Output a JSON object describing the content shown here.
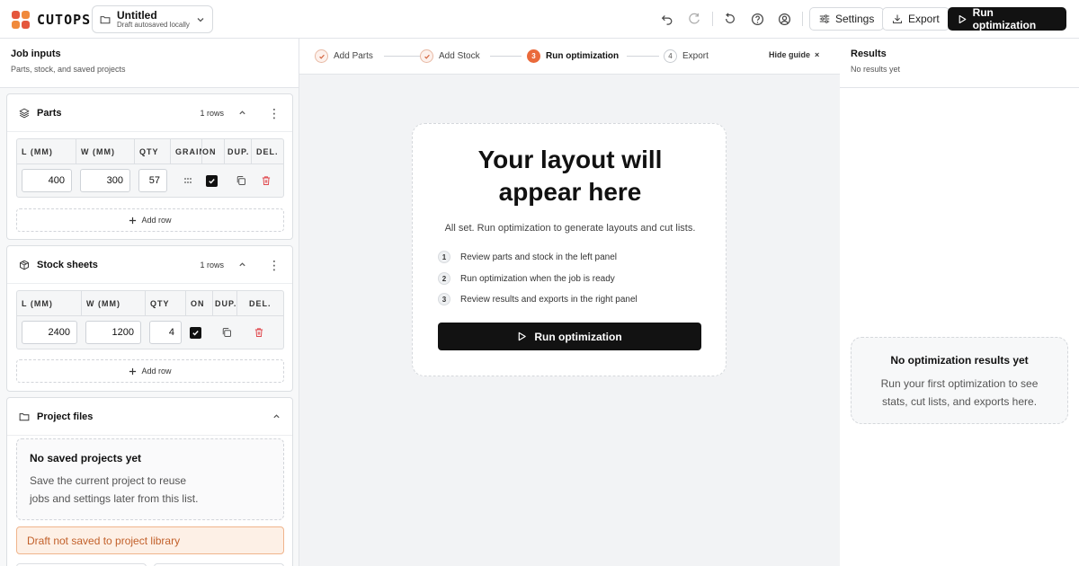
{
  "header": {
    "logo_text": "CUTOPS",
    "project_title": "Untitled",
    "project_status": "Draft autosaved locally",
    "settings_label": "Settings",
    "export_label": "Export",
    "run_label": "Run optimization"
  },
  "left": {
    "title": "Job inputs",
    "subtitle": "Parts, stock, and saved projects",
    "parts": {
      "title": "Parts",
      "rows_count": "1 rows",
      "columns": [
        "L (MM)",
        "W (MM)",
        "QTY",
        "GRAIN",
        "ON",
        "DUP.",
        "DEL."
      ],
      "row": {
        "length": "400",
        "width": "300",
        "qty": "57"
      },
      "add_row_label": "Add row"
    },
    "stock": {
      "title": "Stock sheets",
      "rows_count": "1 rows",
      "columns": [
        "L (MM)",
        "W (MM)",
        "QTY",
        "ON",
        "DUP.",
        "DEL."
      ],
      "row": {
        "length": "2400",
        "width": "1200",
        "qty": "4"
      },
      "add_row_label": "Add row"
    },
    "projects": {
      "title": "Project files",
      "empty_title": "No saved projects yet",
      "empty_desc_1": "Save the current project to reuse",
      "empty_desc_2": "jobs and settings later from this list.",
      "draft_note": "Draft not saved to project library"
    }
  },
  "center": {
    "steps": [
      {
        "num": "",
        "label": "Add Parts",
        "state": "done"
      },
      {
        "num": "",
        "label": "Add Stock",
        "state": "done"
      },
      {
        "num": "3",
        "label": "Run optimization",
        "state": "active"
      },
      {
        "num": "4",
        "label": "Export",
        "state": "pending"
      }
    ],
    "hide_guide": "Hide guide",
    "card": {
      "title_line1": "Your layout will",
      "title_line2": "appear here",
      "subtitle": "All set. Run optimization to generate layouts and cut lists.",
      "items": [
        {
          "num": "1",
          "text": "Review parts and stock in the left panel"
        },
        {
          "num": "2",
          "text": "Run optimization when the job is ready"
        },
        {
          "num": "3",
          "text": "Review results and exports in the right panel"
        }
      ],
      "run_label": "Run optimization"
    }
  },
  "right": {
    "title": "Results",
    "subtitle": "No results yet",
    "empty_title": "No optimization results yet",
    "empty_desc_1": "Run your first optimization to see",
    "empty_desc_2": "stats, cut lists, and exports here."
  },
  "colors": {
    "accent": "#ea6a3b",
    "danger": "#e0474c",
    "primary": "#121212",
    "warning_bg": "#fdf0e6"
  }
}
